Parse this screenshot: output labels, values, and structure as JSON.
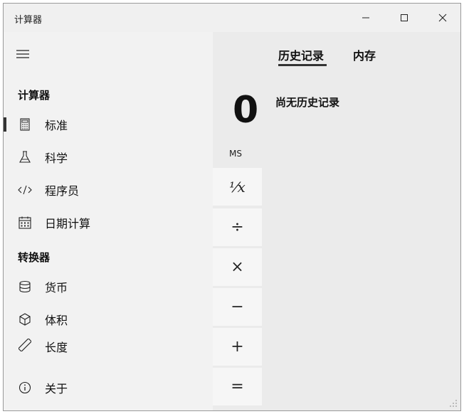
{
  "window": {
    "title": "计算器",
    "min_icon": "minimize-icon",
    "max_icon": "maximize-icon",
    "close_icon": "close-icon"
  },
  "calculator": {
    "display_value": "0",
    "memory_label": "MS",
    "operators": {
      "reciprocal": "¹⁄x",
      "divide": "÷",
      "multiply": "×",
      "subtract": "−",
      "add": "+",
      "equals": "="
    }
  },
  "panel": {
    "tabs": [
      "历史记录",
      "内存"
    ],
    "active_tab": "历史记录",
    "empty_message": "尚无历史记录"
  },
  "nav": {
    "menu_icon": "hamburger-icon",
    "calculator_header": "计算器",
    "converter_header": "转换器",
    "items": [
      {
        "label": "标准",
        "icon": "calculator-icon",
        "active": true
      },
      {
        "label": "科学",
        "icon": "flask-icon"
      },
      {
        "label": "程序员",
        "icon": "code-icon"
      },
      {
        "label": "日期计算",
        "icon": "calendar-icon"
      },
      {
        "label": "货币",
        "icon": "coins-icon"
      },
      {
        "label": "体积",
        "icon": "cube-icon"
      },
      {
        "label": "长度",
        "icon": "ruler-icon"
      },
      {
        "label": "关于",
        "icon": "info-icon"
      }
    ]
  },
  "colors": {
    "accent": "#333333",
    "drawer_bg": "#f2f2f2",
    "calc_bg": "#ebebeb"
  }
}
